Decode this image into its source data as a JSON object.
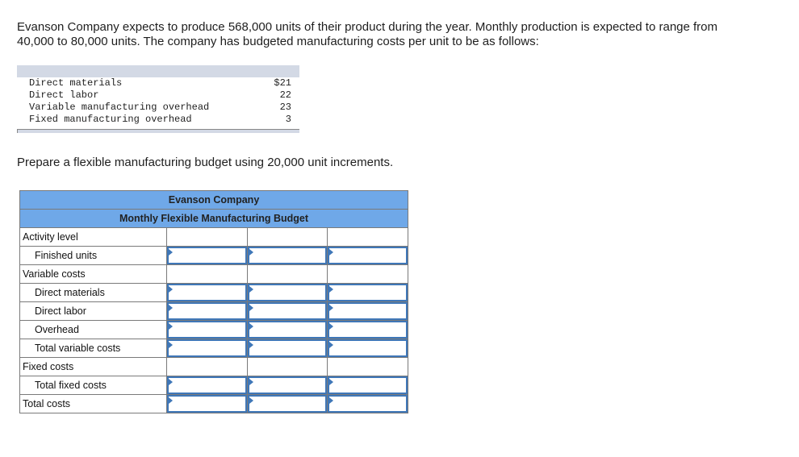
{
  "intro": {
    "line1": "Evanson Company expects to produce 568,000 units of their product during the year. Monthly production is expected to range from",
    "line2": "40,000 to 80,000 units. The company has budgeted manufacturing costs per unit to be as follows:"
  },
  "given_costs": [
    {
      "label": "Direct materials",
      "value": "$21"
    },
    {
      "label": "Direct labor",
      "value": "22"
    },
    {
      "label": "Variable manufacturing overhead",
      "value": "23"
    },
    {
      "label": "Fixed manufacturing overhead",
      "value": "3"
    }
  ],
  "prompt": "Prepare a flexible manufacturing budget using 20,000 unit increments.",
  "budget": {
    "company": "Evanson Company",
    "title": "Monthly Flexible Manufacturing Budget",
    "rows": [
      {
        "label": "Activity level",
        "indent": false,
        "inputs": false
      },
      {
        "label": "Finished units",
        "indent": true,
        "inputs": true
      },
      {
        "label": "Variable costs",
        "indent": false,
        "inputs": false
      },
      {
        "label": "Direct materials",
        "indent": true,
        "inputs": true
      },
      {
        "label": "Direct labor",
        "indent": true,
        "inputs": true
      },
      {
        "label": "Overhead",
        "indent": true,
        "inputs": true
      },
      {
        "label": "Total variable costs",
        "indent": true,
        "inputs": true
      },
      {
        "label": "Fixed costs",
        "indent": false,
        "inputs": false
      },
      {
        "label": "Total fixed costs",
        "indent": true,
        "inputs": true
      },
      {
        "label": "Total costs",
        "indent": false,
        "inputs": true
      }
    ],
    "input_values": [
      [
        "",
        "",
        ""
      ],
      [
        "",
        "",
        ""
      ],
      [
        "",
        "",
        ""
      ],
      [
        "",
        "",
        ""
      ],
      [
        "",
        "",
        ""
      ],
      [
        "",
        "",
        ""
      ],
      [
        "",
        "",
        ""
      ],
      [
        "",
        "",
        ""
      ],
      [
        "",
        "",
        ""
      ],
      [
        "",
        "",
        ""
      ]
    ]
  }
}
